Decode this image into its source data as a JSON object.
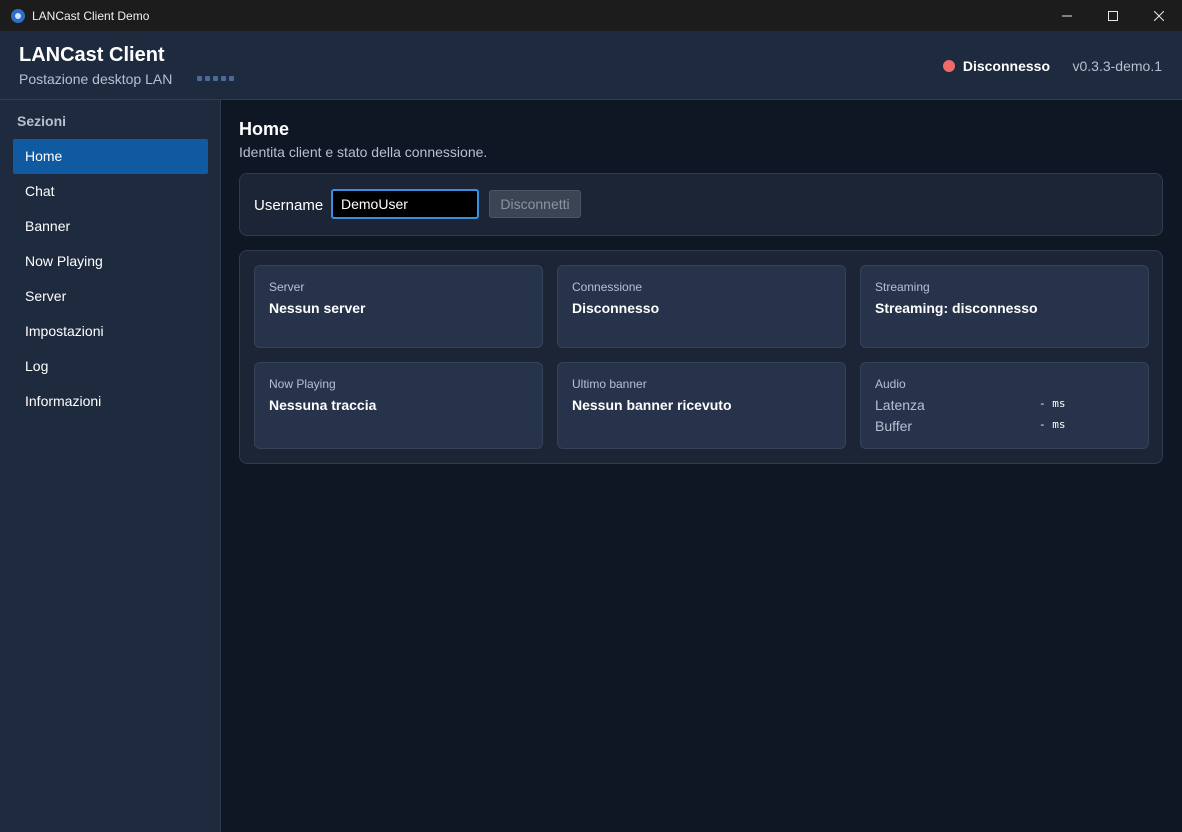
{
  "window": {
    "title": "LANCast Client Demo",
    "icon": "lancast-app-icon"
  },
  "header": {
    "title": "LANCast Client",
    "subtitle": "Postazione desktop LAN",
    "status_text": "Disconnesso",
    "status_color": "#f06a6a",
    "version": "v0.3.3-demo.1"
  },
  "sidebar": {
    "title": "Sezioni",
    "items": [
      {
        "label": "Home",
        "active": true
      },
      {
        "label": "Chat"
      },
      {
        "label": "Banner"
      },
      {
        "label": "Now Playing"
      },
      {
        "label": "Server"
      },
      {
        "label": "Impostazioni"
      },
      {
        "label": "Log"
      },
      {
        "label": "Informazioni"
      }
    ]
  },
  "main": {
    "title": "Home",
    "description": "Identita client e stato della connessione.",
    "username": {
      "label": "Username",
      "value": "DemoUser"
    },
    "disconnect_label": "Disconnetti",
    "cards": {
      "server": {
        "label": "Server",
        "value": "Nessun server"
      },
      "connection": {
        "label": "Connessione",
        "value": "Disconnesso"
      },
      "streaming": {
        "label": "Streaming",
        "value": "Streaming: disconnesso"
      },
      "now_playing": {
        "label": "Now Playing",
        "value": "Nessuna traccia"
      },
      "last_banner": {
        "label": "Ultimo banner",
        "value": "Nessun banner ricevuto"
      },
      "audio": {
        "label": "Audio",
        "latency_label": "Latenza",
        "latency_value": "- ms",
        "buffer_label": "Buffer",
        "buffer_value": "- ms"
      }
    }
  },
  "colors": {
    "accent": "#0f5aa0",
    "background": "#0f1624",
    "panel": "#1b2536",
    "card": "#26334a"
  }
}
